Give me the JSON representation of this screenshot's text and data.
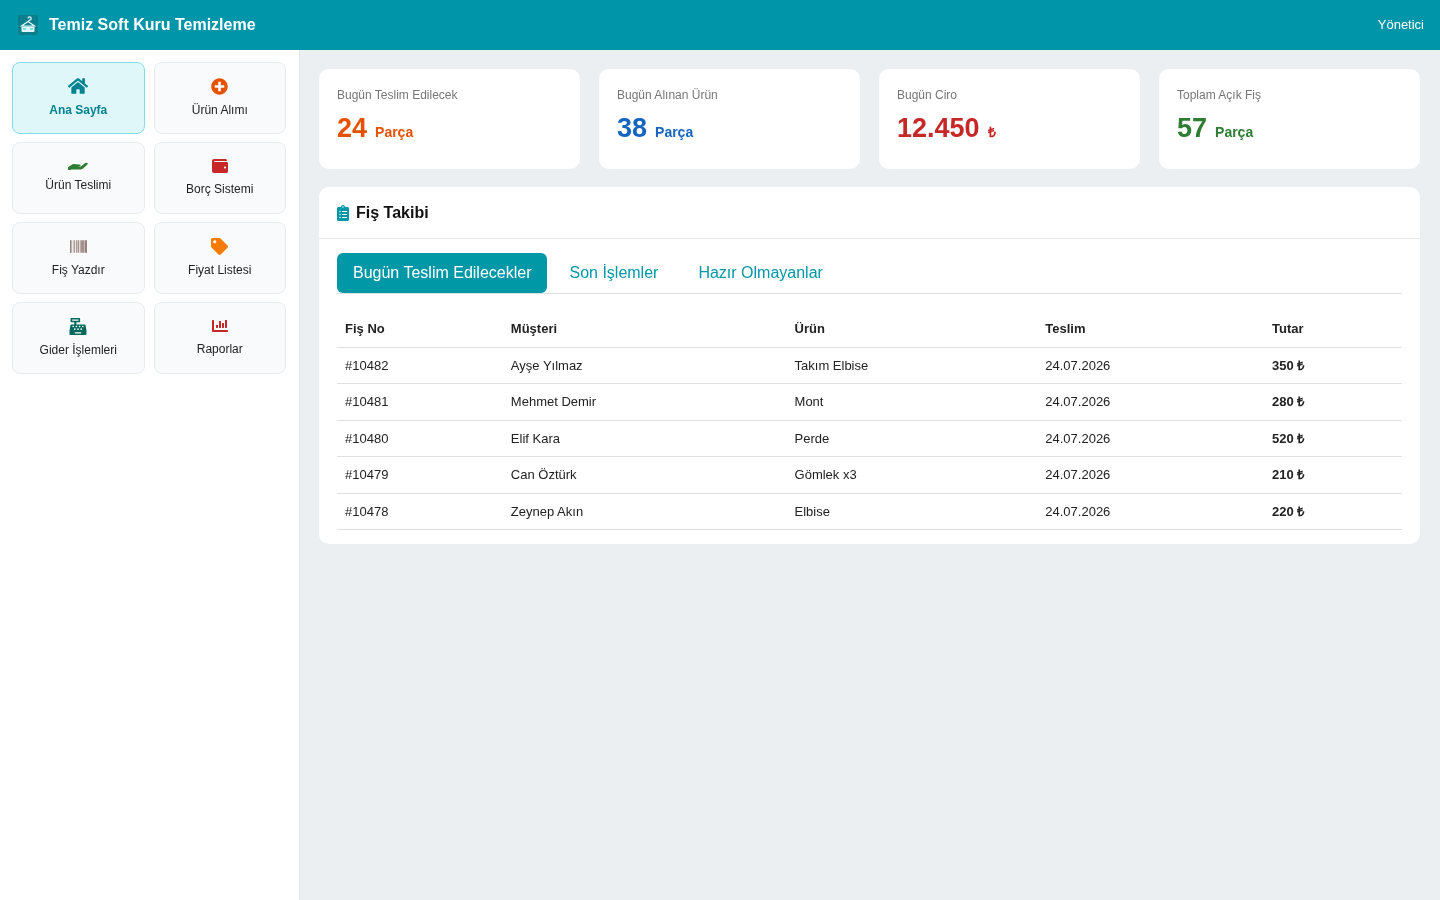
{
  "header": {
    "title": "Temiz Soft Kuru Temizleme",
    "user": "Yönetici"
  },
  "sidebar": {
    "items": [
      {
        "label": "Ana Sayfa",
        "selected": true
      },
      {
        "label": "Ürün Alımı",
        "selected": false
      },
      {
        "label": "Ürün Teslimi",
        "selected": false
      },
      {
        "label": "Borç Sistemi",
        "selected": false
      },
      {
        "label": "Fiş Yazdır",
        "selected": false
      },
      {
        "label": "Fiyat Listesi",
        "selected": false
      },
      {
        "label": "Gider İşlemleri",
        "selected": false
      },
      {
        "label": "Raporlar",
        "selected": false
      }
    ]
  },
  "stats": [
    {
      "label": "Bugün Teslim Edilecek",
      "value": "24",
      "unit": "Parça",
      "color": "#e65100"
    },
    {
      "label": "Bugün Alınan Ürün",
      "value": "38",
      "unit": "Parça",
      "color": "#1565c0"
    },
    {
      "label": "Bugün Ciro",
      "value": "12.450",
      "unit": "₺",
      "color": "#c62828"
    },
    {
      "label": "Toplam Açık Fiş",
      "value": "57",
      "unit": "Parça",
      "color": "#2e7d32"
    }
  ],
  "panel": {
    "title": "Fiş Takibi",
    "tabs": [
      {
        "label": "Bugün Teslim Edilecekler",
        "selected": true
      },
      {
        "label": "Son İşlemler",
        "selected": false
      },
      {
        "label": "Hazır Olmayanlar",
        "selected": false
      }
    ],
    "table": {
      "columns": [
        "Fiş No",
        "Müşteri",
        "Ürün",
        "Teslim",
        "Tutar"
      ],
      "rows": [
        [
          "#10482",
          "Ayşe Yılmaz",
          "Takım Elbise",
          "24.07.2026",
          "350 ₺"
        ],
        [
          "#10481",
          "Mehmet Demir",
          "Mont",
          "24.07.2026",
          "280 ₺"
        ],
        [
          "#10480",
          "Elif Kara",
          "Perde",
          "24.07.2026",
          "520 ₺"
        ],
        [
          "#10479",
          "Can Öztürk",
          "Gömlek x3",
          "24.07.2026",
          "210 ₺"
        ],
        [
          "#10478",
          "Zeynep Akın",
          "Elbise",
          "24.07.2026",
          "220 ₺"
        ]
      ]
    }
  }
}
